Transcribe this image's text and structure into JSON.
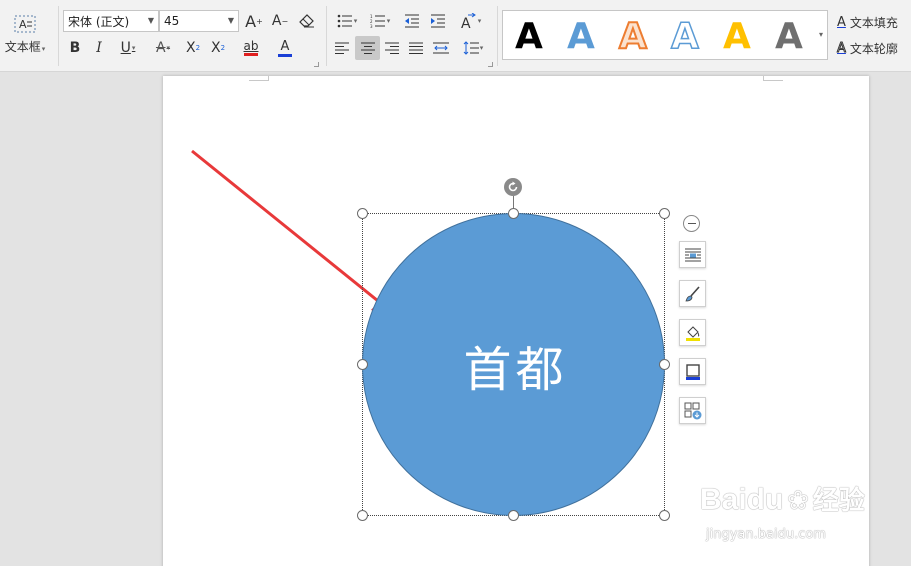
{
  "ribbon": {
    "textbox": {
      "label": "文本框",
      "icon": "textbox-icon"
    },
    "font_name": "宋体 (正文)",
    "font_size": "45",
    "grow_font": "A",
    "shrink_font": "A",
    "bold": "B",
    "italic": "I",
    "underline": "U",
    "strikethrough": "A",
    "superscript": "X",
    "subscript": "X",
    "highlight": "ab",
    "font_color": "A",
    "art_styles": [
      {
        "glyph": "A",
        "style": "black-fill"
      },
      {
        "glyph": "A",
        "style": "blue-fill"
      },
      {
        "glyph": "A",
        "style": "orange-outline"
      },
      {
        "glyph": "A",
        "style": "blue-outline"
      },
      {
        "glyph": "A",
        "style": "yellow-fill"
      },
      {
        "glyph": "A",
        "style": "gray-gradient"
      }
    ],
    "text_fill_label": "文本填充",
    "text_outline_label": "文本轮廓",
    "colors": {
      "highlight": "#e8ff00",
      "font_red": "#e02020",
      "accent": "#1a5fd6"
    }
  },
  "document": {
    "shape_text": "首都",
    "shape_fill": "#5b9bd5",
    "shape_stroke": "#41719c",
    "arrow_color": "#e8393a"
  },
  "side_toolbar": [
    "collapse-icon",
    "text-wrap-icon",
    "brush-icon",
    "fill-icon",
    "outline-icon",
    "layout-options-icon"
  ],
  "watermark": {
    "brand": "Baidu",
    "brand_cn": "经验",
    "url": "jingyan.baidu.com"
  }
}
